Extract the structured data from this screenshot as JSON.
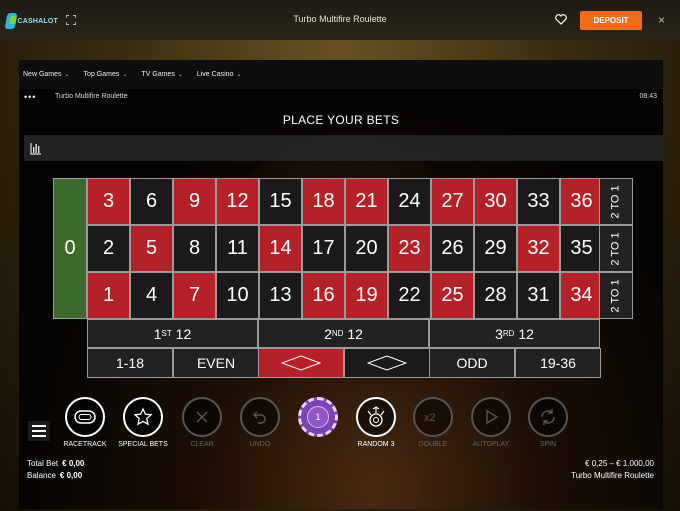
{
  "header": {
    "logo_text": "CASHALOT",
    "title": "Turbo Multifire Roulette",
    "deposit_label": "DEPOSIT",
    "close_label": "×"
  },
  "nav": [
    {
      "label": "New Games"
    },
    {
      "label": "Top Games"
    },
    {
      "label": "TV Games"
    },
    {
      "label": "Live Casino"
    }
  ],
  "game": {
    "menu_dots": "•••",
    "name": "Turbo Multifire Roulette",
    "time": "08:43",
    "status": "PLACE YOUR BETS"
  },
  "table": {
    "zero": "0",
    "rows": [
      [
        {
          "n": "3",
          "c": "red"
        },
        {
          "n": "6",
          "c": "blk"
        },
        {
          "n": "9",
          "c": "red"
        },
        {
          "n": "12",
          "c": "red"
        },
        {
          "n": "15",
          "c": "blk"
        },
        {
          "n": "18",
          "c": "red"
        },
        {
          "n": "21",
          "c": "red"
        },
        {
          "n": "24",
          "c": "blk"
        },
        {
          "n": "27",
          "c": "red"
        },
        {
          "n": "30",
          "c": "red"
        },
        {
          "n": "33",
          "c": "blk"
        },
        {
          "n": "36",
          "c": "red"
        }
      ],
      [
        {
          "n": "2",
          "c": "blk"
        },
        {
          "n": "5",
          "c": "red"
        },
        {
          "n": "8",
          "c": "blk"
        },
        {
          "n": "11",
          "c": "blk"
        },
        {
          "n": "14",
          "c": "red"
        },
        {
          "n": "17",
          "c": "blk"
        },
        {
          "n": "20",
          "c": "blk"
        },
        {
          "n": "23",
          "c": "red"
        },
        {
          "n": "26",
          "c": "blk"
        },
        {
          "n": "29",
          "c": "blk"
        },
        {
          "n": "32",
          "c": "red"
        },
        {
          "n": "35",
          "c": "blk"
        }
      ],
      [
        {
          "n": "1",
          "c": "red"
        },
        {
          "n": "4",
          "c": "blk"
        },
        {
          "n": "7",
          "c": "red"
        },
        {
          "n": "10",
          "c": "blk"
        },
        {
          "n": "13",
          "c": "blk"
        },
        {
          "n": "16",
          "c": "red"
        },
        {
          "n": "19",
          "c": "red"
        },
        {
          "n": "22",
          "c": "blk"
        },
        {
          "n": "25",
          "c": "red"
        },
        {
          "n": "28",
          "c": "blk"
        },
        {
          "n": "31",
          "c": "blk"
        },
        {
          "n": "34",
          "c": "red"
        }
      ]
    ],
    "column_bet": [
      "2",
      "TO",
      "1"
    ],
    "dozens": [
      {
        "num": "1",
        "sup": "ST",
        "label": "12"
      },
      {
        "num": "2",
        "sup": "ND",
        "label": "12"
      },
      {
        "num": "3",
        "sup": "RD",
        "label": "12"
      }
    ],
    "even_bets": [
      "1-18",
      "EVEN",
      "",
      "",
      "ODD",
      "19-36"
    ],
    "colors": {
      "red": "#b62027",
      "black": "#1a1a1a",
      "zero": "#3b6a2a"
    }
  },
  "controls": [
    {
      "label": "RACETRACK",
      "icon": "racetrack-icon",
      "enabled": true
    },
    {
      "label": "SPECIAL BETS",
      "icon": "star-icon",
      "enabled": true
    },
    {
      "label": "CLEAR",
      "icon": "close-icon",
      "enabled": false
    },
    {
      "label": "UNDO",
      "icon": "undo-icon",
      "enabled": false
    },
    {
      "label": "",
      "icon": "chip-icon",
      "enabled": true,
      "chip_value": "1"
    },
    {
      "label": "RANDOM 3",
      "icon": "random-icon",
      "enabled": true
    },
    {
      "label": "DOUBLE",
      "icon": "double-icon",
      "enabled": false
    },
    {
      "label": "AUTOPLAY",
      "icon": "play-icon",
      "enabled": false
    },
    {
      "label": "SPIN",
      "icon": "spin-icon",
      "enabled": false
    }
  ],
  "footer": {
    "total_bet_label": "Total Bet",
    "total_bet_value": "€ 0,00",
    "balance_label": "Balance",
    "balance_value": "€ 0,00",
    "limits": "€ 0,25 – € 1.000,00",
    "game_name": "Turbo Multifire Roulette"
  }
}
